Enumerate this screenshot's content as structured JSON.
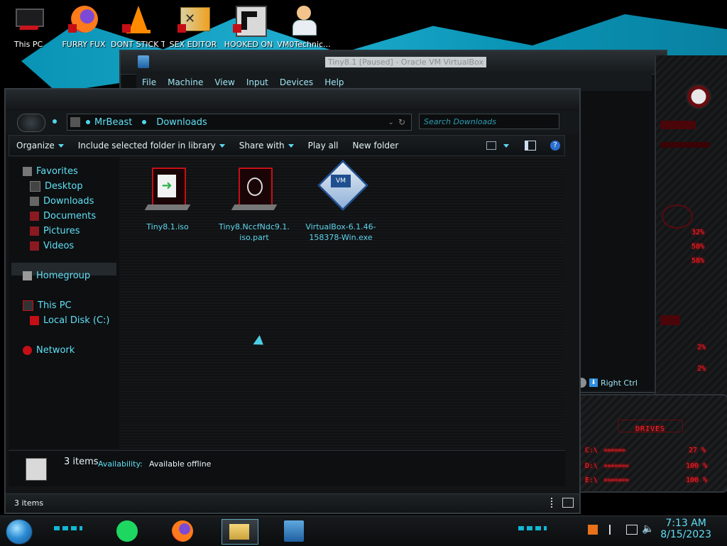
{
  "desktop": {
    "icons": [
      {
        "label": "This PC"
      },
      {
        "label": "FURRY FUX"
      },
      {
        "label": "DONT STICK T"
      },
      {
        "label": "SEX EDITOR"
      },
      {
        "label": "HOOKED ON"
      },
      {
        "label": "VM0Technic..."
      }
    ]
  },
  "vbox": {
    "title": "Tiny8.1 [Paused] - Oracle VM VirtualBox",
    "menu": [
      "File",
      "Machine",
      "View",
      "Input",
      "Devices",
      "Help"
    ],
    "host_key": "Right Ctrl"
  },
  "gadgets": {
    "cpu_percents": [
      "32%",
      "58%",
      "58%"
    ],
    "small_percents": [
      "2%",
      "2%"
    ],
    "drives_title": "DRIVES",
    "drives": [
      {
        "letter": "C:\\",
        "value": "27 %"
      },
      {
        "letter": "D:\\",
        "value": "100 %"
      },
      {
        "letter": "E:\\",
        "value": "100 %"
      }
    ]
  },
  "explorer": {
    "breadcrumb": [
      "MrBeast",
      "Downloads"
    ],
    "search_placeholder": "Search Downloads",
    "toolbar": {
      "organize": "Organize",
      "include": "Include selected folder in library",
      "share": "Share with",
      "play": "Play all",
      "new_folder": "New folder"
    },
    "nav": {
      "favorites": "Favorites",
      "desktop": "Desktop",
      "downloads": "Downloads",
      "documents": "Documents",
      "pictures": "Pictures",
      "videos": "Videos",
      "homegroup": "Homegroup",
      "this_pc": "This PC",
      "local_disk": "Local Disk (C:)",
      "network": "Network"
    },
    "files": [
      {
        "name": "Tiny8.1.iso"
      },
      {
        "name": "Tiny8.NccfNdc9.1.iso.part"
      },
      {
        "name": "VirtualBox-6.1.46-158378-Win.exe"
      }
    ],
    "details": {
      "count": "3 items",
      "availability_label": "Availability:",
      "availability_value": "Available offline"
    },
    "status": "3 items"
  },
  "taskbar": {
    "time": "7:13 AM",
    "date": "8/15/2023"
  },
  "colors": {
    "accent_cyan": "#5fe0f5",
    "alert_red": "#ff1f2a"
  }
}
